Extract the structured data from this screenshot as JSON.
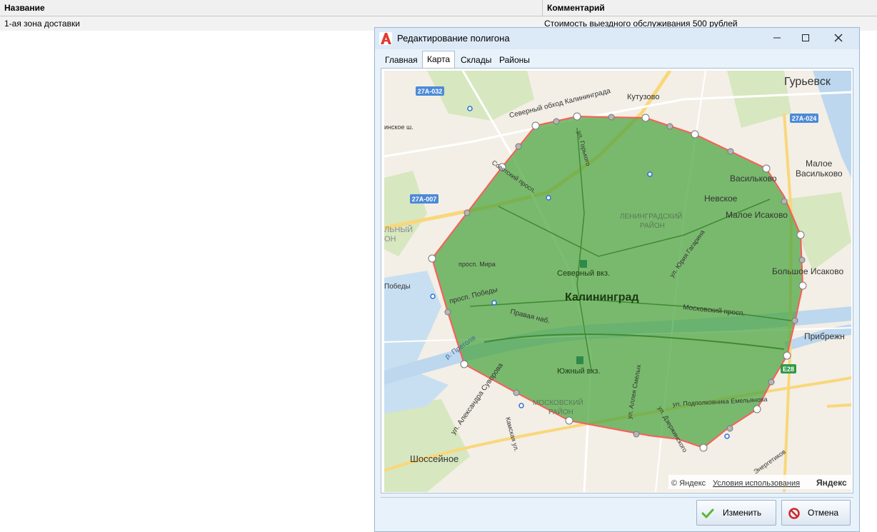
{
  "grid": {
    "columns": [
      "Название",
      "Комментарий"
    ],
    "rows": [
      {
        "name": "1-ая зона доставки",
        "comment": "Стоимость выездного обслуживания 500 рублей"
      }
    ]
  },
  "dialog": {
    "title": "Редактирование полигона",
    "tabs": [
      "Главная",
      "Карта",
      "Склады",
      "Районы"
    ],
    "active_tab": "Карта",
    "ok_label": "Изменить",
    "cancel_label": "Отмена"
  },
  "map": {
    "labels": {
      "city": "Калининград",
      "guryevsk": "Гурьевск",
      "kutuzovo": "Кутузово",
      "maloe_vasilkovo": "Малое\nВасильково",
      "vasilkovo": "Васильково",
      "nevskoe": "Невское",
      "maloe_isakovo": "Малое Исаково",
      "bolshoe_isakovo": "Большое Исаково",
      "pribrezhny": "Прибрежн",
      "shosseinoe": "Шоссейное",
      "leningradsky": "ЛЕНИНГРАДСКИЙ\nРАЙОН",
      "moskovsky_rayon": "МОСКОВСКИЙ\nРАЙОН",
      "severny_vkz": "Северный вкз.",
      "yuzhny_vkz": "Южный вкз.",
      "obkhod": "Северный обход Калининграда",
      "ul_gorkogo": "ул. Горького",
      "sovetsky": "Советский просп.",
      "pr_mira": "просп. Мира",
      "pr_pobedy": "просп. Победы",
      "pobedy": "Победы",
      "pravaya": "Правая наб.",
      "pregolya": "р. Преголя",
      "yuria": "ул. Юрия Гагарина",
      "moskovsky_pr": "Московский просп.",
      "podpolkovnika": "ул. Подполковника Емельянова",
      "dzerzhinskogo": "ул. Дзержинского",
      "aleksandra": "ул. Александра Суворова",
      "kamskaya": "Камская ул.",
      "allei": "ул. Аллея Смелых",
      "energetikov": "Энергетиков",
      "lny": "ЛЬНЫЙ\nОН",
      "inskoe": "инское ш.",
      "copyright": "© Яндекс",
      "terms": "Условия использования",
      "yandex": "Яндекс"
    },
    "shields": [
      "27А-032",
      "27А-024",
      "27А-007",
      "E28"
    ],
    "colors": {
      "polygon_fill": "#4aa33f",
      "polygon_stroke": "#ff5a5a",
      "land": "#f3efe6",
      "water": "#bcd7ee",
      "park": "#cfe3b5",
      "road": "#ffffff",
      "major_road": "#f9d77a"
    }
  }
}
